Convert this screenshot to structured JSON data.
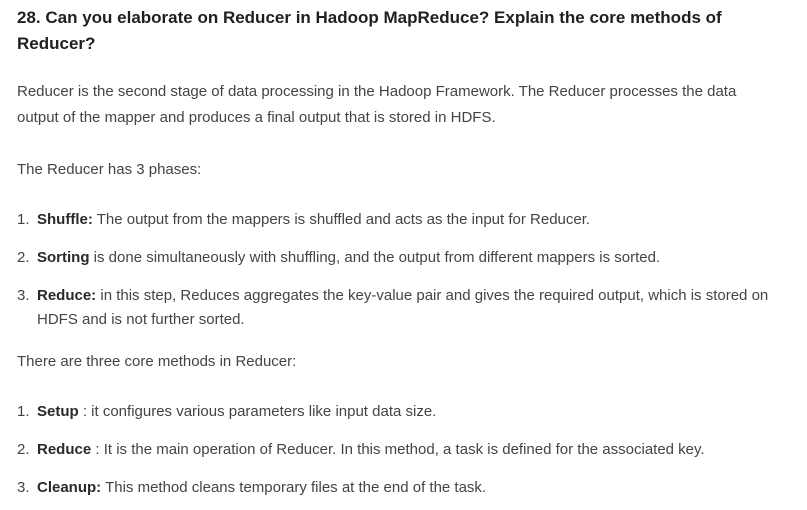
{
  "title": "28. Can you elaborate on Reducer in Hadoop MapReduce? Explain the core methods of Reducer?",
  "intro": "Reducer is the second stage of data processing in the Hadoop Framework. The Reducer processes the data output of the mapper and produces a final output that is stored in HDFS.",
  "phases_intro": "The Reducer has 3 phases:",
  "phases": [
    {
      "number": "1.",
      "term": "Shuffle:",
      "text": " The output from the mappers is shuffled and acts as the input for Reducer."
    },
    {
      "number": "2.",
      "term": "Sorting",
      "text": " is done simultaneously with shuffling, and the output from different mappers is sorted."
    },
    {
      "number": "3.",
      "term": "Reduce:",
      "text": " in this step, Reduces aggregates the key-value pair and gives the required output, which is stored on HDFS and is not further sorted."
    }
  ],
  "methods_intro": "There are three core methods in Reducer:",
  "methods": [
    {
      "number": "1.",
      "term": "Setup",
      "text": " : it configures various parameters like input data size."
    },
    {
      "number": "2.",
      "term": "Reduce",
      "text": " : It is the main operation of Reducer. In this method, a task is defined for the associated key."
    },
    {
      "number": "3.",
      "term": "Cleanup:",
      "text": " This method cleans temporary files at the end of the task."
    }
  ]
}
